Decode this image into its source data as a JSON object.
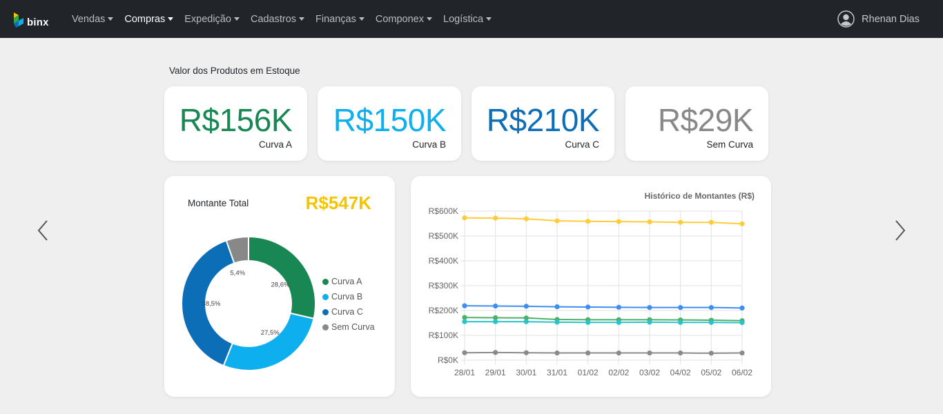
{
  "navbar": {
    "brand": "binx",
    "items": [
      {
        "label": "Vendas",
        "active": false
      },
      {
        "label": "Compras",
        "active": true
      },
      {
        "label": "Expedição",
        "active": false
      },
      {
        "label": "Cadastros",
        "active": false
      },
      {
        "label": "Finanças",
        "active": false
      },
      {
        "label": "Componex",
        "active": false
      },
      {
        "label": "Logística",
        "active": false
      }
    ],
    "user_name": "Rhenan Dias"
  },
  "section_title": "Valor dos Produtos em Estoque",
  "kpis": [
    {
      "value": "R$156K",
      "label": "Curva A",
      "color": "#198754"
    },
    {
      "value": "R$150K",
      "label": "Curva B",
      "color": "#0dafef"
    },
    {
      "value": "R$210K",
      "label": "Curva C",
      "color": "#0d6eb8"
    },
    {
      "value": "R$29K",
      "label": "Sem Curva",
      "color": "#888888"
    }
  ],
  "donut_card": {
    "title": "Montante Total",
    "total": "R$547K"
  },
  "chart_data": [
    {
      "type": "pie",
      "donut": true,
      "slices": [
        {
          "name": "Curva A",
          "value": 28.6,
          "label": "28,6%",
          "color": "#198754"
        },
        {
          "name": "Curva B",
          "value": 27.5,
          "label": "27,5%",
          "color": "#0dafef"
        },
        {
          "name": "Curva C",
          "value": 38.5,
          "label": "38,5%",
          "color": "#0d6eb8"
        },
        {
          "name": "Sem Curva",
          "value": 5.4,
          "label": "5,4%",
          "color": "#888888"
        }
      ],
      "legend": "right"
    },
    {
      "type": "line",
      "title": "Histórico de Montantes (R$)",
      "x": [
        "28/01",
        "29/01",
        "30/01",
        "31/01",
        "01/02",
        "02/02",
        "03/02",
        "04/02",
        "05/02",
        "06/02"
      ],
      "yticks": [
        "R$0K",
        "R$100K",
        "R$200K",
        "R$300K",
        "R$400K",
        "R$500K",
        "R$600K"
      ],
      "ylim": [
        0,
        600
      ],
      "grid": true,
      "series": [
        {
          "color": "#ffcd3c",
          "values": [
            573,
            572,
            569,
            561,
            559,
            558,
            557,
            555,
            555,
            549
          ]
        },
        {
          "color": "#3d8ef0",
          "values": [
            219,
            218,
            217,
            215,
            214,
            213,
            212,
            212,
            212,
            210
          ]
        },
        {
          "color": "#4caf6b",
          "values": [
            172,
            171,
            170,
            164,
            163,
            163,
            163,
            162,
            161,
            159
          ]
        },
        {
          "color": "#2cc3c8",
          "values": [
            155,
            155,
            155,
            153,
            152,
            152,
            153,
            152,
            152,
            151
          ]
        },
        {
          "color": "#8a8a8a",
          "values": [
            30,
            31,
            30,
            29,
            29,
            29,
            29,
            29,
            28,
            29
          ]
        }
      ]
    }
  ]
}
